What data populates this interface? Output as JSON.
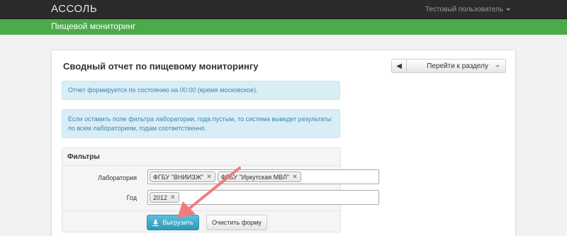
{
  "header": {
    "brand": "АССОЛЬ",
    "user": "Тестовый пользователь"
  },
  "subheader": {
    "title": "Пищевой мониторинг"
  },
  "report": {
    "title": "Сводный отчет по пищевому мониторингу",
    "goto_section": "Перейти к разделу",
    "alerts": [
      "Отчет формируется по состоянию на 00:00 (время московское).",
      "Если оставить поле фильтра лаборатории, года пустым, то система выведет результаты по всем лабораториям, годам соответственно."
    ],
    "filters": {
      "title": "Фильтры",
      "lab_label": "Лаборатория",
      "labs": [
        "ФГБУ \"ВНИИЗЖ\"",
        "ФГБУ \"Иркутская МВЛ\""
      ],
      "year_label": "Год",
      "years": [
        "2012"
      ],
      "export_label": "Выгрузить",
      "clear_label": "Очистить форму"
    }
  },
  "colors": {
    "topbar": "#2b2b2b",
    "subbar": "#4caa4a",
    "info_bg": "#d9edf7",
    "info_text": "#3a87ad",
    "primary_button": "#2f96b4",
    "annotation_arrow": "#f07d7d"
  },
  "icons": {
    "back": "chevron-left-icon",
    "export": "download-icon",
    "remove": "close-icon"
  }
}
